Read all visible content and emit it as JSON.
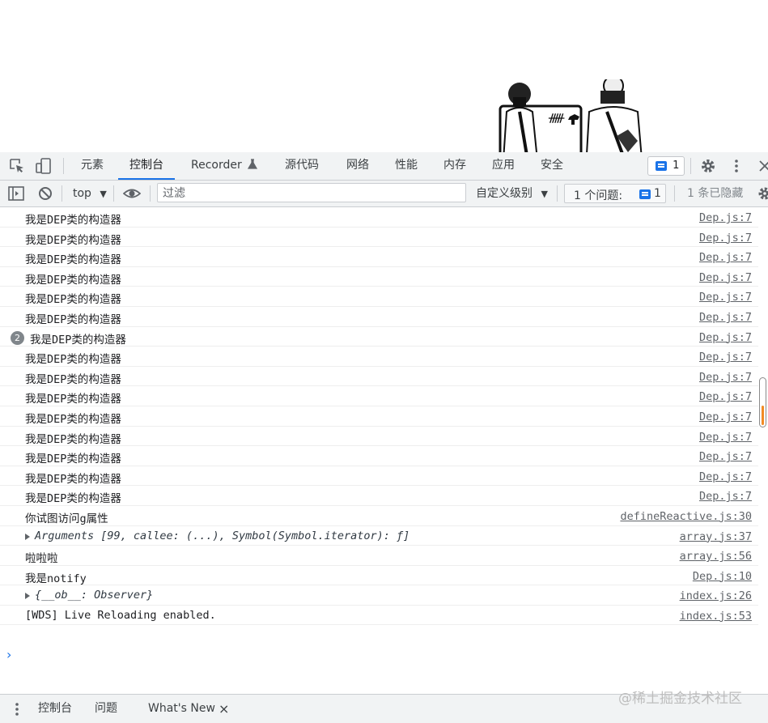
{
  "tabs": [
    {
      "label": "元素"
    },
    {
      "label": "控制台"
    },
    {
      "label": "Recorder"
    },
    {
      "label": "源代码"
    },
    {
      "label": "网络"
    },
    {
      "label": "性能"
    },
    {
      "label": "内存"
    },
    {
      "label": "应用"
    },
    {
      "label": "安全"
    }
  ],
  "tab_issue_count": "1",
  "toolbar": {
    "context": "top",
    "filter_placeholder": "过滤",
    "levels": "自定义级别",
    "issues_label": "1 个问题:",
    "issues_count": "1",
    "hidden": "1 条已隐藏"
  },
  "log": [
    {
      "text": "我是DEP类的构造器",
      "source": "Dep.js:7"
    },
    {
      "text": "我是DEP类的构造器",
      "source": "Dep.js:7"
    },
    {
      "text": "我是DEP类的构造器",
      "source": "Dep.js:7"
    },
    {
      "text": "我是DEP类的构造器",
      "source": "Dep.js:7"
    },
    {
      "text": "我是DEP类的构造器",
      "source": "Dep.js:7"
    },
    {
      "text": "我是DEP类的构造器",
      "source": "Dep.js:7"
    },
    {
      "text": "我是DEP类的构造器",
      "source": "Dep.js:7",
      "count": "2"
    },
    {
      "text": "我是DEP类的构造器",
      "source": "Dep.js:7"
    },
    {
      "text": "我是DEP类的构造器",
      "source": "Dep.js:7"
    },
    {
      "text": "我是DEP类的构造器",
      "source": "Dep.js:7"
    },
    {
      "text": "我是DEP类的构造器",
      "source": "Dep.js:7"
    },
    {
      "text": "我是DEP类的构造器",
      "source": "Dep.js:7"
    },
    {
      "text": "我是DEP类的构造器",
      "source": "Dep.js:7"
    },
    {
      "text": "我是DEP类的构造器",
      "source": "Dep.js:7"
    },
    {
      "text": "我是DEP类的构造器",
      "source": "Dep.js:7"
    },
    {
      "text": "你试图访问g属性",
      "source": "defineReactive.js:30"
    },
    {
      "text": "Arguments [99, callee: (...), Symbol(Symbol.iterator): ƒ]",
      "source": "array.js:37",
      "expandable": true
    },
    {
      "text": "啦啦啦",
      "source": "array.js:56"
    },
    {
      "text": "我是notify",
      "source": "Dep.js:10"
    },
    {
      "text": "{__ob__: Observer}",
      "source": "index.js:26",
      "expandable": true
    },
    {
      "text": "[WDS] Live Reloading enabled.",
      "source": "index.js:53"
    }
  ],
  "prompt_symbol": "›",
  "drawer": {
    "tabs": [
      {
        "label": "控制台"
      },
      {
        "label": "问题"
      },
      {
        "label": "What's New"
      }
    ],
    "close": "×"
  },
  "watermark": "@稀土掘金技术社区"
}
